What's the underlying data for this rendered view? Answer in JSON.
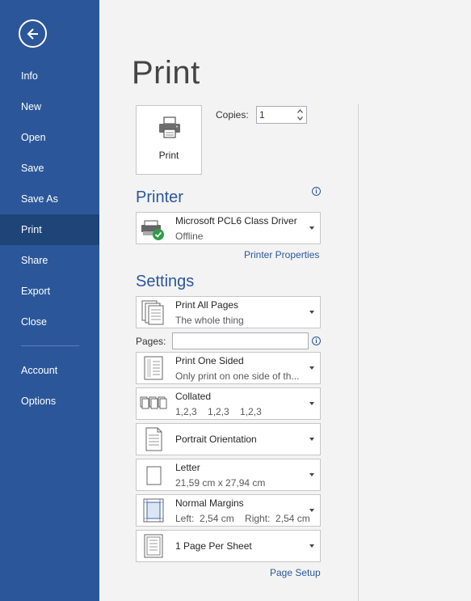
{
  "sidebar": {
    "items": [
      {
        "label": "Info"
      },
      {
        "label": "New"
      },
      {
        "label": "Open"
      },
      {
        "label": "Save"
      },
      {
        "label": "Save As"
      },
      {
        "label": "Print",
        "active": true
      },
      {
        "label": "Share"
      },
      {
        "label": "Export"
      },
      {
        "label": "Close"
      },
      {
        "label": "Account"
      },
      {
        "label": "Options"
      }
    ],
    "back_icon": "back-arrow-icon"
  },
  "main": {
    "title": "Print",
    "print_button_label": "Print",
    "copies_label": "Copies:",
    "copies_value": "1",
    "printer_section_title": "Printer",
    "printer": {
      "name": "Microsoft PCL6 Class Driver",
      "status": "Offline"
    },
    "printer_properties_link": "Printer Properties",
    "settings_section_title": "Settings",
    "settings": [
      {
        "line1": "Print All Pages",
        "line2": "The whole thing"
      },
      {
        "line1": "Print One Sided",
        "line2": "Only print on one side of th..."
      },
      {
        "line1": "Collated",
        "line2": "1,2,3    1,2,3    1,2,3"
      },
      {
        "line1": "Portrait Orientation"
      },
      {
        "line1": "Letter",
        "line2": "21,59 cm x 27,94 cm"
      },
      {
        "line1": "Normal Margins",
        "line2": "Left:  2,54 cm    Right:  2,54 cm"
      },
      {
        "line1": "1 Page Per Sheet"
      }
    ],
    "pages_label": "Pages:",
    "pages_value": "",
    "page_setup_link": "Page Setup"
  },
  "colors": {
    "accent": "#2b579a",
    "sidebar_active": "#1e4478",
    "status_ok": "#2e9e48"
  }
}
